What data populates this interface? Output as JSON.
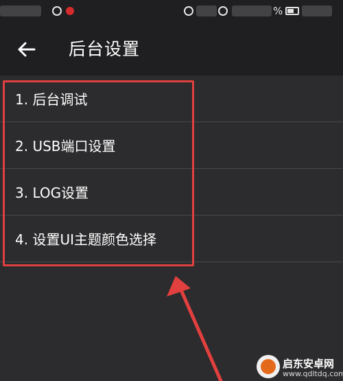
{
  "status_bar": {
    "battery_symbol": "%"
  },
  "header": {
    "back_icon": "arrow-left-icon",
    "title": "后台设置"
  },
  "menu": {
    "items": [
      {
        "label": "1. 后台调试"
      },
      {
        "label": "2. USB端口设置"
      },
      {
        "label": "3. LOG设置"
      },
      {
        "label": "4. 设置UI主题颜色选择"
      }
    ]
  },
  "annotation": {
    "color": "#e2403f"
  },
  "watermark": {
    "title": "启东安卓网",
    "url": "www.qdltdq.com"
  }
}
